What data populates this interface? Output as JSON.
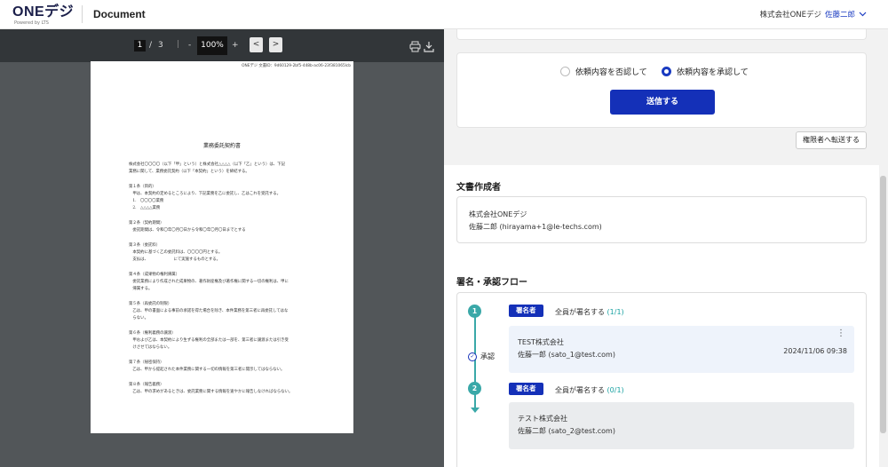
{
  "header": {
    "logo_text": "ONEデジ",
    "logo_sub": "Powered by LTS",
    "doc_title": "Document",
    "company": "株式会社ONEデジ",
    "user_name": "佐藤二郎",
    "dropdown_icon": "chevron-down-icon"
  },
  "viewer": {
    "page_current": "1",
    "page_sep": "/",
    "page_total": "3",
    "zoom_minus": "-",
    "zoom": "100%",
    "zoom_plus": "+",
    "prev": "<",
    "next": ">",
    "icons": [
      "print-icon",
      "download-icon"
    ]
  },
  "document": {
    "id_line": "ONEデジ 文書ID：9d60129-2bf5-448b-ac06-23f381065lcb",
    "title": "業務委託契約書",
    "lines": [
      "株式会社〇〇〇〇（以下「甲」という）と株式会社△△△△（以下「乙」という）は、下記",
      "業務に関して、業務委託契約（以下「本契約」という）を締結する。",
      "",
      "第１条（目的）",
      "　甲は、本契約の定めるところにより、下記業務を乙に委託し、乙はこれを受託する。",
      "　1.　〇〇〇〇業務",
      "　2.　△△△△業務",
      "",
      "第２条（契約期間）",
      "　委託期間は、令和〇年〇月〇日から令和〇年〇月〇日までとする",
      "",
      "第３条（委託料）",
      "　本契約に基づく乙の委託料は、〇〇〇〇円とする。",
      "　支払は、　　　　　　　にて実施するものとする。",
      "",
      "第４条（成果物の権利帰属）",
      "　委託業務により作成された成果物の、著作財産権及び著作権に関する一切の権利は、甲に",
      "　帰属する。",
      "",
      "第５条（再委託の制限）",
      "　乙は、甲の書面による事前の承諾を得た場合を除き、本件業務を第三者に再委託してはな",
      "　らない。",
      "",
      "第６条（権利義務の譲渡）",
      "　甲および乙は、本契約により生ずる権利の全部または一部を、第三者に譲渡または引き受",
      "　けさせてはならない。",
      "",
      "第７条（秘密保持）",
      "　乙は、甲から提起された本件業務に関する一切の情報を第三者に開示してはならない。",
      "",
      "第８条（報告義務）",
      "　乙は、甲の求めがあるときは、委託業務に関する情報を速やかに報告しなければならない。"
    ]
  },
  "response": {
    "reject_label": "依頼内容を否認して",
    "approve_label": "依頼内容を承認して",
    "selected": "approve",
    "send_label": "送信する",
    "forward_label": "権限者へ転送する"
  },
  "author": {
    "heading": "文書作成者",
    "company": "株式会社ONEデジ",
    "person": "佐藤二郎 (hirayama+1@le-techs.com)"
  },
  "flow": {
    "heading": "署名・承認フロー",
    "steps": [
      {
        "number": "1",
        "tag": "署名者",
        "desc": "全員が署名する",
        "count": "(1/1)",
        "status": "承認",
        "company": "TEST株式会社",
        "person": "佐藤一郎 (sato_1@test.com)",
        "date": "2024/11/06 09:38",
        "more": "⋮"
      },
      {
        "number": "2",
        "tag": "署名者",
        "desc": "全員が署名する",
        "count": "(0/1)",
        "company": "テスト株式会社",
        "person": "佐藤二郎 (sato_2@test.com)"
      }
    ]
  },
  "colors": {
    "primary": "#1430b8",
    "teal": "#3aa8a8",
    "viewer_bg": "#525659",
    "toolbar_bg": "#323639",
    "approved_box": "#eef3fb",
    "pending_box": "#eaecee"
  }
}
